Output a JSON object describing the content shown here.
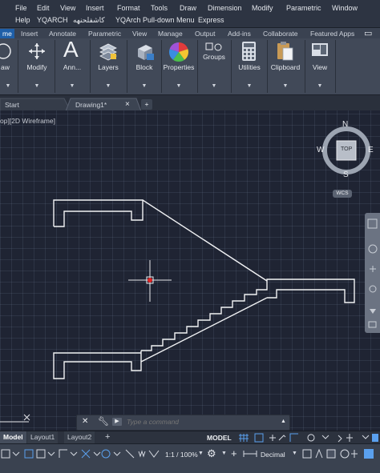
{
  "menubar": {
    "row1": [
      "File",
      "Edit",
      "View",
      "Insert",
      "Format",
      "Tools",
      "Draw",
      "Dimension",
      "Modify",
      "Parametric",
      "Window"
    ],
    "row2": [
      "Help",
      "YQARCH",
      "كاشفلحنهه",
      "YQArch Pull-down Menu",
      "Express"
    ]
  },
  "ribbon_tabs": {
    "active": "me",
    "items": [
      "Insert",
      "Annotate",
      "Parametric",
      "View",
      "Manage",
      "Output",
      "Add-ins",
      "Collaborate",
      "Featured Apps"
    ]
  },
  "ribbon": {
    "draw": "aw",
    "modify": "Modify",
    "annotation": "Ann...",
    "layers": "Layers",
    "block": "Block",
    "properties": "Properties",
    "groups": "Groups",
    "utilities": "Utilities",
    "clipboard": "Clipboard",
    "view": "View"
  },
  "file_tabs": {
    "start": "Start",
    "drawing": "Drawing1*",
    "close": "×",
    "add": "+"
  },
  "viewport": {
    "label": "op][2D Wireframe]",
    "viewcube": {
      "top": "TOP",
      "north": "N",
      "south": "S",
      "east": "E",
      "west": "W",
      "wcs": "WCS"
    }
  },
  "command": {
    "placeholder": "Type a command"
  },
  "layout_tabs": {
    "model": "Model",
    "layout1": "Layout1",
    "layout2": "Layout2",
    "add": "+"
  },
  "statusbar": {
    "model": "MODEL",
    "scale": "1:1 / 100%",
    "units": "Decimal"
  }
}
